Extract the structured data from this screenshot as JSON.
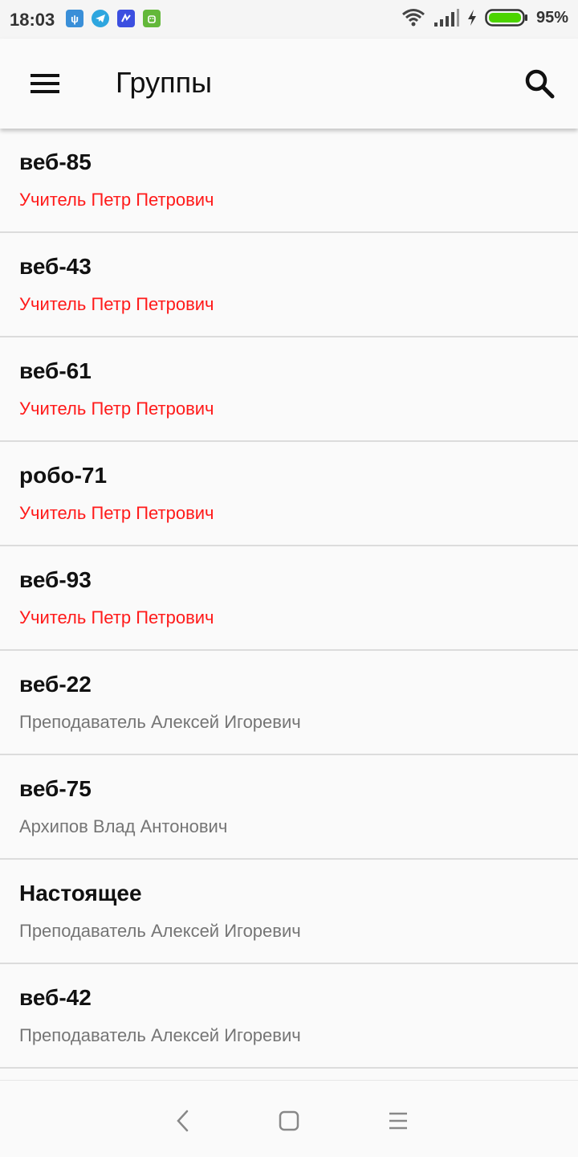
{
  "status_bar": {
    "time": "18:03",
    "battery": "95%",
    "notification_icons": [
      "usb-icon",
      "telegram-icon",
      "app-icon",
      "android-icon"
    ],
    "indicators": [
      "wifi-icon",
      "signal-icon",
      "charging-icon",
      "battery-icon"
    ]
  },
  "app_bar": {
    "title": "Группы",
    "menu_icon": "hamburger-menu-icon",
    "search_icon": "search-icon"
  },
  "colors": {
    "teacher_highlight": "#ff1a1a",
    "subtitle_default": "#757575",
    "battery_green": "#4cd400"
  },
  "groups": [
    {
      "name": "веб-85",
      "teacher": "Учитель Петр Петрович",
      "highlight": true
    },
    {
      "name": "веб-43",
      "teacher": "Учитель Петр Петрович",
      "highlight": true
    },
    {
      "name": "веб-61",
      "teacher": "Учитель Петр Петрович",
      "highlight": true
    },
    {
      "name": "робо-71",
      "teacher": "Учитель Петр Петрович",
      "highlight": true
    },
    {
      "name": "веб-93",
      "teacher": "Учитель Петр Петрович",
      "highlight": true
    },
    {
      "name": "веб-22",
      "teacher": "Преподаватель Алексей Игоревич",
      "highlight": false
    },
    {
      "name": "веб-75",
      "teacher": "Архипов Влад Антонович",
      "highlight": false
    },
    {
      "name": "Настоящее",
      "teacher": "Преподаватель Алексей Игоревич",
      "highlight": false
    },
    {
      "name": "веб-42",
      "teacher": "Преподаватель Алексей Игоревич",
      "highlight": false
    }
  ],
  "nav_bar": {
    "buttons": [
      "back-icon",
      "home-icon",
      "recents-icon"
    ]
  }
}
